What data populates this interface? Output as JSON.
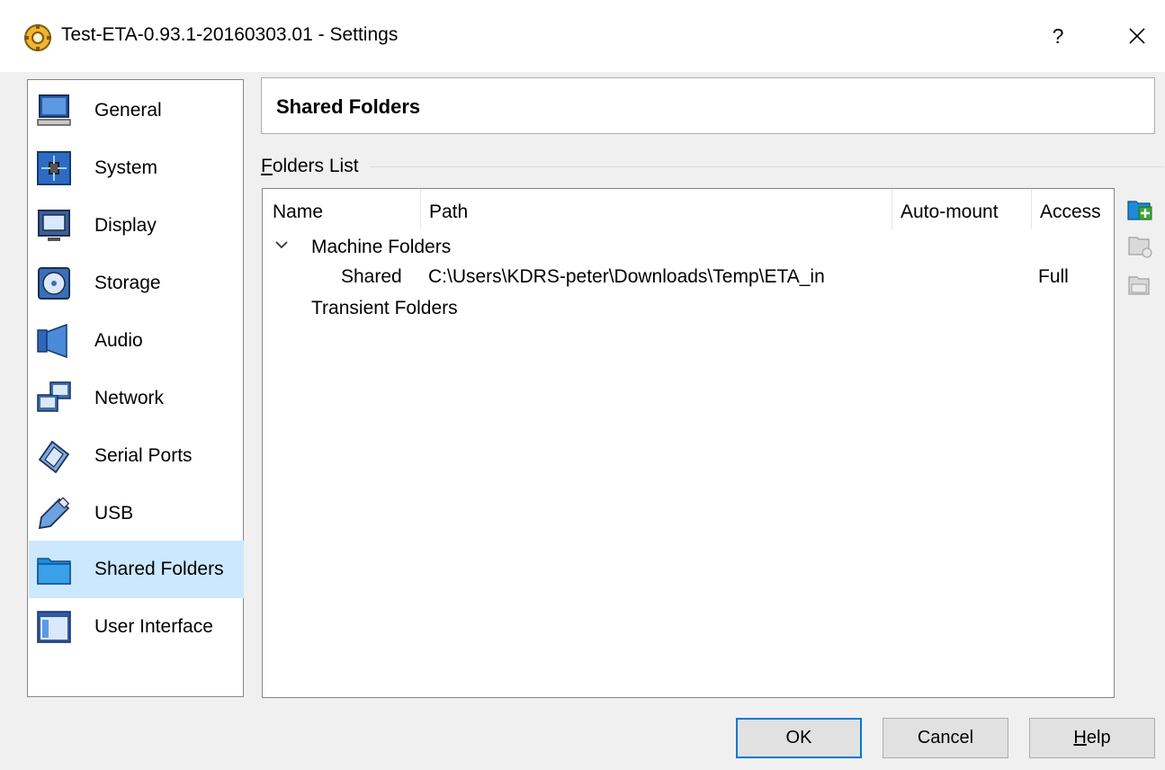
{
  "window": {
    "title": "Test-ETA-0.93.1-20160303.01 - Settings",
    "help_glyph": "?",
    "icons": {
      "app": "virtualbox-gear-icon",
      "close": "close-icon"
    }
  },
  "sidebar": {
    "items": [
      {
        "label": "General",
        "icon": "monitor-icon",
        "selected": false
      },
      {
        "label": "System",
        "icon": "chip-icon",
        "selected": false
      },
      {
        "label": "Display",
        "icon": "display-icon",
        "selected": false
      },
      {
        "label": "Storage",
        "icon": "disc-icon",
        "selected": false
      },
      {
        "label": "Audio",
        "icon": "speaker-icon",
        "selected": false
      },
      {
        "label": "Network",
        "icon": "network-icon",
        "selected": false
      },
      {
        "label": "Serial Ports",
        "icon": "serial-port-icon",
        "selected": true,
        "selected_note": false
      },
      {
        "label": "USB",
        "icon": "usb-icon",
        "selected": false
      },
      {
        "label": "Shared Folders",
        "icon": "folder-icon",
        "selected": true
      },
      {
        "label": "User Interface",
        "icon": "window-icon",
        "selected": false
      }
    ],
    "selected_color": "#cce8ff"
  },
  "page": {
    "title": "Shared Folders",
    "group_label_accel": "F",
    "group_label_rest": "olders List"
  },
  "folders": {
    "columns": [
      "Name",
      "Path",
      "Auto-mount",
      "Access"
    ],
    "machine_group": "Machine Folders",
    "machine_rows": [
      {
        "name": "Shared",
        "path": "C:\\Users\\KDRS-peter\\Downloads\\Temp\\ETA_in",
        "auto_mount": "",
        "access": "Full"
      }
    ],
    "transient_group": "Transient Folders"
  },
  "toolbar": {
    "add_icon": "add-folder-icon",
    "edit_icon": "edit-folder-icon",
    "remove_icon": "remove-folder-icon"
  },
  "buttons": {
    "ok": "OK",
    "cancel": "Cancel",
    "help_accel": "H",
    "help_rest": "elp"
  },
  "colors": {
    "accent": "#0078d7",
    "folder": "#1f8ad9",
    "add_green": "#3aa935"
  }
}
